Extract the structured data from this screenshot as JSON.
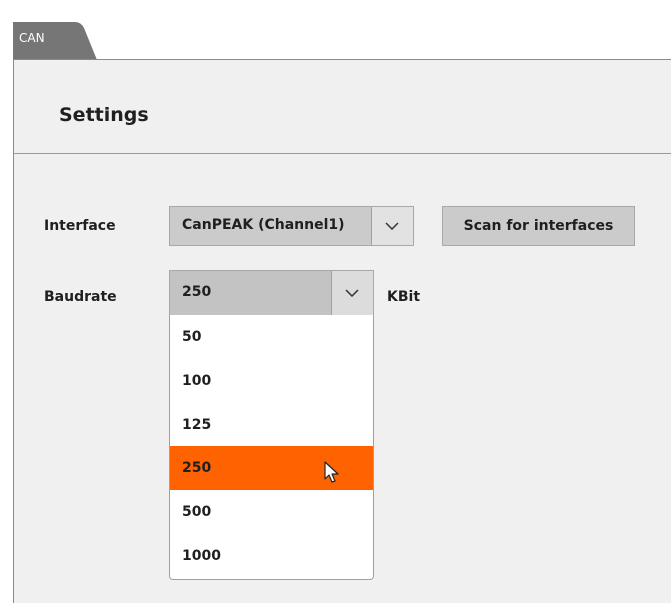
{
  "tab": {
    "label": "CAN"
  },
  "header": {
    "title": "Settings"
  },
  "interface": {
    "label": "Interface",
    "selected": "CanPEAK (Channel1)",
    "scan_button": "Scan for interfaces"
  },
  "baudrate": {
    "label": "Baudrate",
    "selected": "250",
    "unit": "KBit",
    "options": [
      "50",
      "100",
      "125",
      "250",
      "500",
      "1000"
    ],
    "highlighted": "250"
  },
  "colors": {
    "accent": "#ff6200",
    "tab": "#767676",
    "panel": "#f0f0f0",
    "control": "#cbcbcb"
  },
  "icons": {
    "combo_arrow": "chevron-down-icon",
    "cursor": "mouse-pointer-icon"
  }
}
